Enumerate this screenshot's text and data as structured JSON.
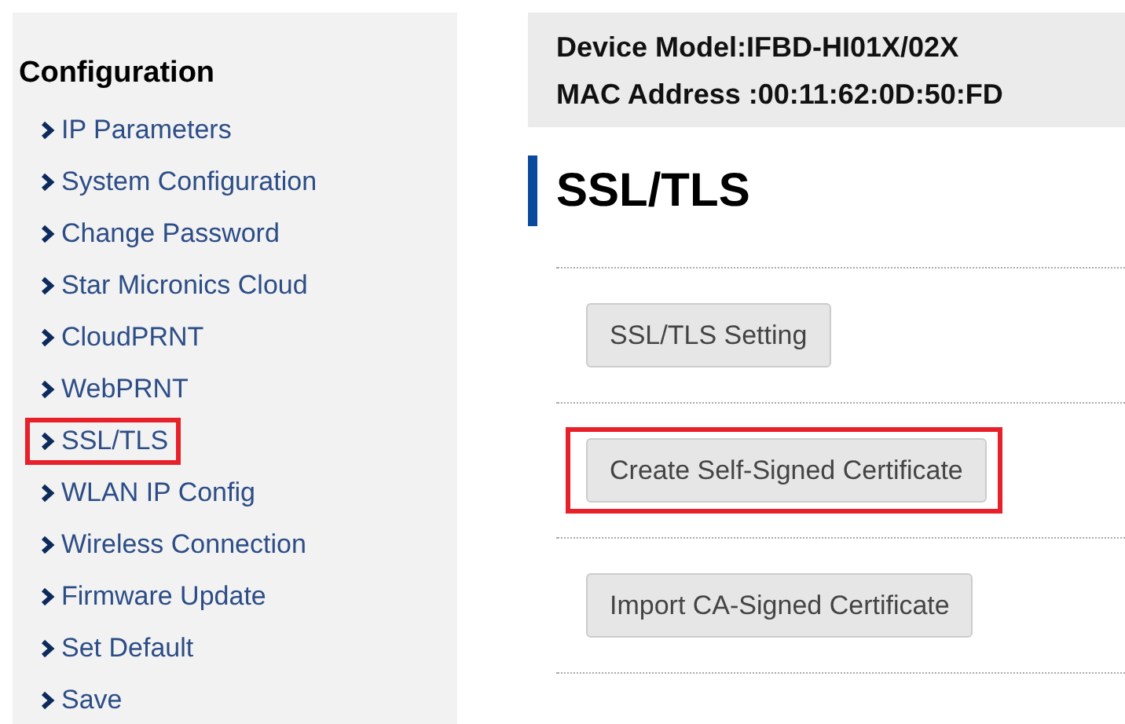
{
  "sidebar": {
    "heading": "Configuration",
    "items": [
      {
        "label": "IP Parameters",
        "highlighted": false
      },
      {
        "label": "System Configuration",
        "highlighted": false
      },
      {
        "label": "Change Password",
        "highlighted": false
      },
      {
        "label": "Star Micronics Cloud",
        "highlighted": false
      },
      {
        "label": "CloudPRNT",
        "highlighted": false
      },
      {
        "label": "WebPRNT",
        "highlighted": false
      },
      {
        "label": "SSL/TLS",
        "highlighted": true
      },
      {
        "label": "WLAN IP Config",
        "highlighted": false
      },
      {
        "label": "Wireless Connection",
        "highlighted": false
      },
      {
        "label": "Firmware Update",
        "highlighted": false
      },
      {
        "label": "Set Default",
        "highlighted": false
      },
      {
        "label": "Save",
        "highlighted": false
      }
    ]
  },
  "device_info": [
    "Device Model:IFBD-HI01X/02X",
    "MAC Address :00:11:62:0D:50:FD"
  ],
  "page_title": "SSL/TLS",
  "buttons": [
    {
      "label": "SSL/TLS Setting",
      "highlighted": false
    },
    {
      "label": "Create Self-Signed Certificate",
      "highlighted": true
    },
    {
      "label": "Import CA-Signed Certificate",
      "highlighted": false
    }
  ]
}
